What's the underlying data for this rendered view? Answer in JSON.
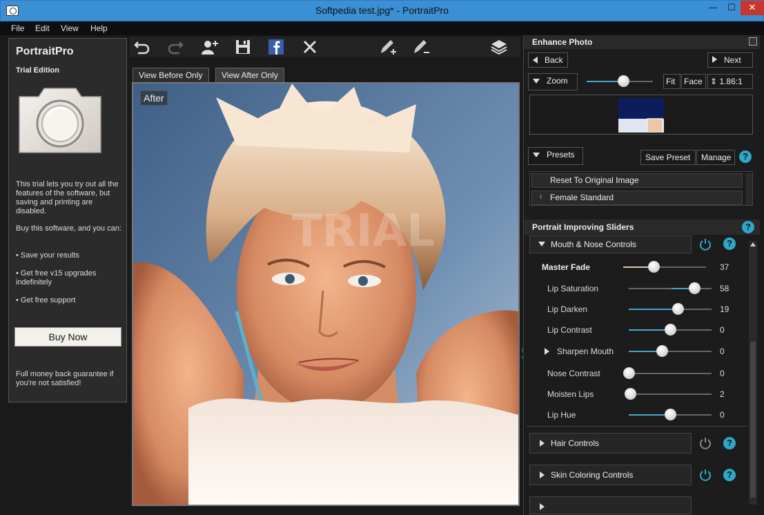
{
  "window": {
    "title": "Softpedia test.jpg* - PortraitPro",
    "min": "—",
    "max": "☐",
    "close": "✕"
  },
  "menu": {
    "items": [
      "File",
      "Edit",
      "View",
      "Help"
    ]
  },
  "left_panel": {
    "brand": "PortraitPro",
    "edition": "Trial Edition",
    "para1": "This trial lets you try out all the features of the software, but saving and printing are disabled.",
    "para2": "Buy this software, and you can:",
    "bullets": [
      "Save your results",
      "Get free v15 upgrades indefinitely",
      "Get free support"
    ],
    "buy_label": "Buy Now",
    "guarantee": "Full money back guarantee if you're not satisfied!"
  },
  "view_tabs": {
    "before": "View Before Only",
    "after": "View After Only"
  },
  "image": {
    "overlay_label": "After",
    "watermark": "TRIAL"
  },
  "enhance": {
    "header": "Enhance Photo",
    "back": "Back",
    "next": "Next",
    "zoom_label": "Zoom",
    "fit": "Fit",
    "face": "Face",
    "zoom_value": "1.86:1",
    "zoom_level": 0.55
  },
  "presets": {
    "label": "Presets",
    "save": "Save Preset",
    "manage": "Manage",
    "items": [
      "Reset To Original Image",
      "Female Standard"
    ]
  },
  "sliders_panel": {
    "header": "Portrait Improving Sliders",
    "section": "Mouth & Nose Controls",
    "master": {
      "label": "Master Fade",
      "value": "37",
      "level": 0.37
    },
    "sliders": [
      {
        "label": "Lip Saturation",
        "value": "58",
        "level": 0.79
      },
      {
        "label": "Lip Darken",
        "value": "19",
        "level": 0.59
      },
      {
        "label": "Lip Contrast",
        "value": "0",
        "level": 0.5
      },
      {
        "label": "Sharpen Mouth",
        "value": "0",
        "level": 0.4
      },
      {
        "label": "Nose Contrast",
        "value": "0",
        "level": 0.0
      },
      {
        "label": "Moisten Lips",
        "value": "2",
        "level": 0.02
      },
      {
        "label": "Lip Hue",
        "value": "0",
        "level": 0.5
      }
    ],
    "more_sections": [
      "Hair Controls",
      "Skin Coloring Controls"
    ]
  },
  "watermark_text": "SOFTPEDIA",
  "help_glyph": "?"
}
